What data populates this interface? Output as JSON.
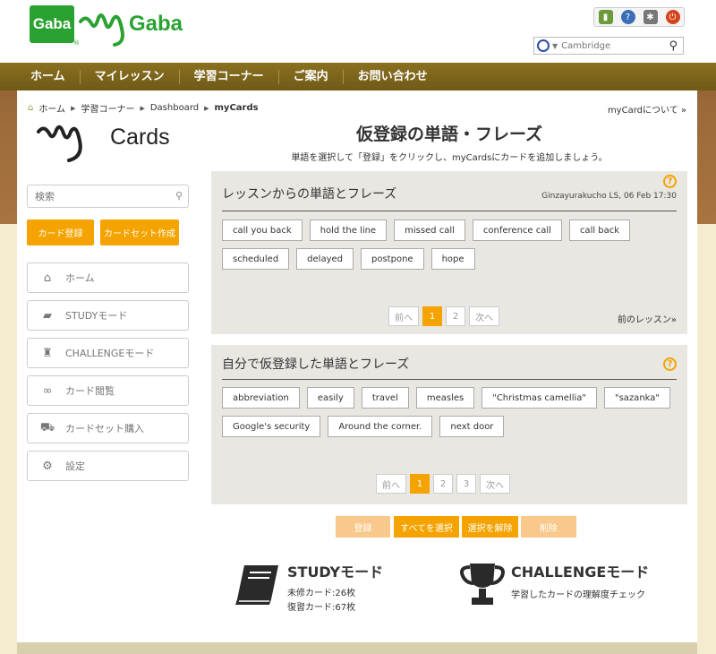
{
  "header": {
    "logo_gaba": "Gaba",
    "logo_my_gaba": "my Gaba",
    "dictionary_search": {
      "placeholder": "Cambridge"
    }
  },
  "nav": {
    "items": [
      {
        "label": "ホーム"
      },
      {
        "label": "マイレッスン"
      },
      {
        "label": "学習コーナー"
      },
      {
        "label": "ご案内"
      },
      {
        "label": "お問い合わせ"
      }
    ]
  },
  "breadcrumb": [
    "ホーム",
    "学習コーナー",
    "Dashboard",
    "myCards"
  ],
  "about_link": "myCardについて »",
  "logo_mycards": "my Cards",
  "page": {
    "title": "仮登録の単語・フレーズ",
    "subtitle": "単語を選択して「登録」をクリックし、myCardsにカードを追加しましょう。"
  },
  "sidebar": {
    "search_placeholder": "検索",
    "register_button": "カード登録",
    "create_set_button": "カードセット作成",
    "menu": [
      {
        "label": "ホーム",
        "icon": "home-icon"
      },
      {
        "label": "STUDYモード",
        "icon": "book-icon"
      },
      {
        "label": "CHALLENGEモード",
        "icon": "trophy-icon"
      },
      {
        "label": "カード閲覧",
        "icon": "binoculars-icon"
      },
      {
        "label": "カードセット購入",
        "icon": "cart-icon"
      },
      {
        "label": "設定",
        "icon": "gear-icon"
      }
    ]
  },
  "lesson_box": {
    "title": "レッスンからの単語とフレーズ",
    "meta": "Ginzayurakucho LS, 06 Feb  17:30",
    "chips": [
      "call you back",
      "hold the line",
      "missed call",
      "conference call",
      "call back",
      "scheduled",
      "delayed",
      "postpone",
      "hope"
    ],
    "pager": {
      "prev": "前へ",
      "pages": [
        "1",
        "2"
      ],
      "next": "次へ",
      "current": "1"
    },
    "prev_lesson": "前のレッスン»"
  },
  "self_box": {
    "title": "自分で仮登録した単語とフレーズ",
    "chips": [
      "abbreviation",
      "easily",
      "travel",
      "measles",
      "\"Christmas camellia\"",
      "\"sazanka\"",
      "Google's security",
      "Around the corner.",
      "next door"
    ],
    "pager": {
      "prev": "前へ",
      "pages": [
        "1",
        "2",
        "3"
      ],
      "next": "次へ",
      "current": "1"
    }
  },
  "actions": {
    "register": "登録",
    "select_all": "すべてを選択",
    "deselect": "選択を解除",
    "delete": "削除"
  },
  "modes": {
    "study": {
      "title": "STUDYモード",
      "unlearned": "未修カード:26枚",
      "review": "復習カード:67枚"
    },
    "challenge": {
      "title": "CHALLENGEモード",
      "desc": "学習したカードの理解度チェック"
    }
  },
  "colors": {
    "accent": "#f5a300",
    "nav": "#7a6418",
    "brand_green": "#2aa232"
  }
}
